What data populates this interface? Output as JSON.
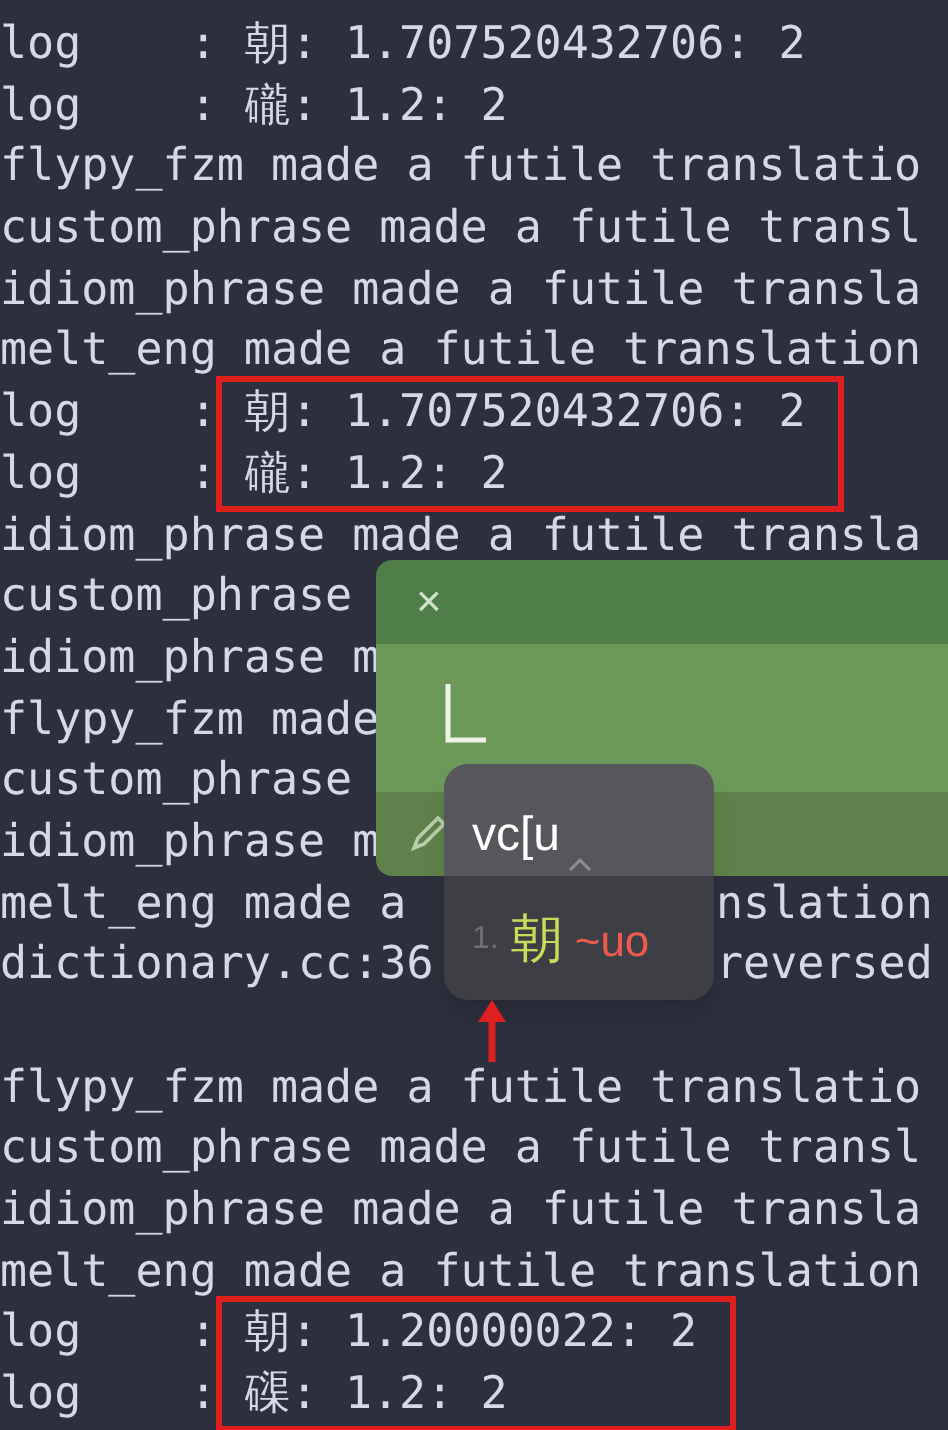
{
  "terminal": {
    "rows": [
      {
        "kind": "log",
        "label": "log    :",
        "text": "朝: 1.707520432706: 2",
        "highlighted": false
      },
      {
        "kind": "log",
        "label": "log    :",
        "text": "礲: 1.2: 2",
        "highlighted": false
      },
      {
        "kind": "plain",
        "text": "flypy_fzm made a futile translatio"
      },
      {
        "kind": "plain",
        "text": "custom_phrase made a futile transl"
      },
      {
        "kind": "plain",
        "text": "idiom_phrase made a futile transla"
      },
      {
        "kind": "plain",
        "text": "melt_eng made a futile translation"
      },
      {
        "kind": "log",
        "label": "log    :",
        "text": "朝: 1.707520432706: 2",
        "highlighted": true
      },
      {
        "kind": "log",
        "label": "log    :",
        "text": "礲: 1.2: 2",
        "highlighted": true
      },
      {
        "kind": "plain",
        "text": "idiom_phrase made a futile transla"
      },
      {
        "kind": "plain",
        "text": "custom_phrase"
      },
      {
        "kind": "plain",
        "text": "idiom_phrase m"
      },
      {
        "kind": "plain",
        "text": "flypy_fzm made"
      },
      {
        "kind": "plain",
        "text": "custom_phrase"
      },
      {
        "kind": "plain",
        "text": "idiom_phrase m"
      },
      {
        "kind": "split",
        "text": "melt_eng made a",
        "right_text": "nslation"
      },
      {
        "kind": "split",
        "text": "dictionary.cc:36",
        "right_text": "reversed"
      },
      {
        "kind": "blank"
      },
      {
        "kind": "plain",
        "text": "flypy_fzm made a futile translatio"
      },
      {
        "kind": "plain",
        "text": "custom_phrase made a futile transl"
      },
      {
        "kind": "plain",
        "text": "idiom_phrase made a futile transla"
      },
      {
        "kind": "plain",
        "text": "melt_eng made a futile translation"
      },
      {
        "kind": "log",
        "label": "log    :",
        "text": "朝: 1.20000022: 2",
        "highlighted": true
      },
      {
        "kind": "log",
        "label": "log    :",
        "text": "磲: 1.2: 2",
        "highlighted": true
      }
    ]
  },
  "input_window": {
    "close": "×"
  },
  "candidate_popup": {
    "preedit": "vc[u",
    "candidates": [
      {
        "index": "1.",
        "text": "朝",
        "comment": "~uo"
      }
    ]
  }
}
